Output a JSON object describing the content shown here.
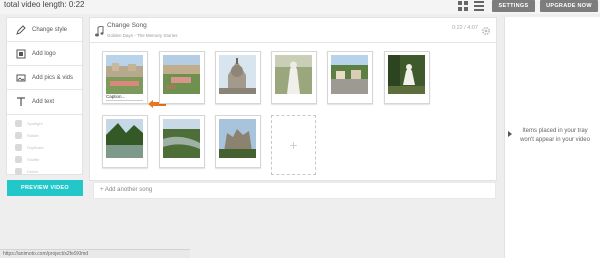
{
  "header": {
    "total_label": "total video length: 0:22",
    "settings_label": "SETTINGS",
    "upgrade_label": "UPGRADE NOW"
  },
  "tools": {
    "items": [
      {
        "label": "Change style",
        "icon": "pen-icon"
      },
      {
        "label": "Add logo",
        "icon": "logo-icon"
      },
      {
        "label": "Add pics & vids",
        "icon": "media-icon"
      },
      {
        "label": "Add text",
        "icon": "text-icon"
      }
    ],
    "minor": [
      "Spotlight",
      "Rotate",
      "Duplicate",
      "Shuffle",
      "Delete"
    ],
    "preview_label": "PREVIEW VIDEO"
  },
  "song": {
    "title": "Change Song",
    "subtitle": "Golden Days - The Memory Stories",
    "time": "0:22 / 4:07"
  },
  "gallery": {
    "caption_placeholder": "Caption...",
    "add_symbol": "+"
  },
  "add_song_label": "+ Add another song",
  "right_panel": {
    "message": "Items placed in your tray won't appear in your video"
  },
  "status": {
    "url": "https://animoto.com/project/s2fe9Xlmd"
  },
  "colors": {
    "accent": "#21c7c9",
    "button_dark": "#7d7d7d",
    "arrow": "#e87722"
  }
}
